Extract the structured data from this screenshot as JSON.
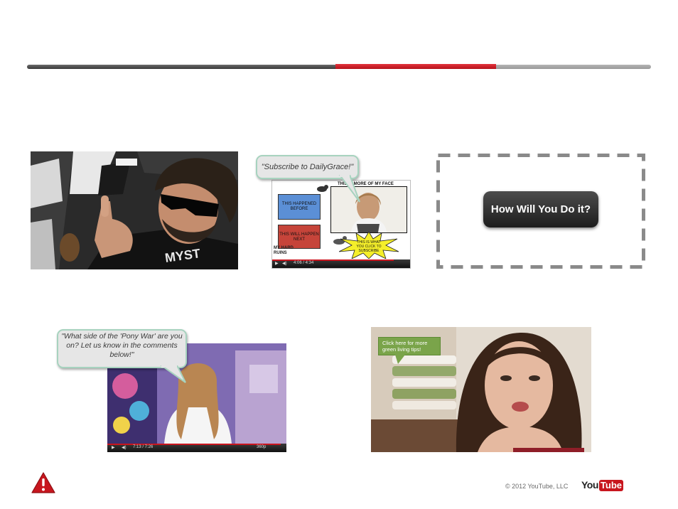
{
  "slide": {
    "bubble_dailygrace": "\"Subscribe to DailyGrace!\"",
    "bubble_pony": "\"What side of the 'Pony War' are you on?  Let us know in the comments below!\"",
    "how_button": "How Will You Do it?",
    "green_tip": "Click here for more green living tips!",
    "copyright": "© 2012 YouTube, LLC",
    "logo_you": "You",
    "logo_tube": "Tube"
  },
  "thumb2": {
    "header": "THIS IS MORE OF MY FACE",
    "box_before": "THIS HAPPENED BEFORE",
    "box_next": "THIS WILL HAPPEN NEXT",
    "burst": "THIS IS WHAT YOU CLICK TO SUBSCRIBE",
    "logo": "MY HARD RUINS",
    "time": "4:06 / 4:34"
  },
  "thumb4": {
    "time": "7:13 / 7:26",
    "quality": "360p"
  },
  "shirt_text": "MYST",
  "progress": {
    "viewed_fraction": 0.495,
    "current_segment_end_fraction": 0.751
  },
  "colors": {
    "accent_red": "#c9141d",
    "bubble_border": "#a7d3bf",
    "green": "#7aa44a"
  }
}
